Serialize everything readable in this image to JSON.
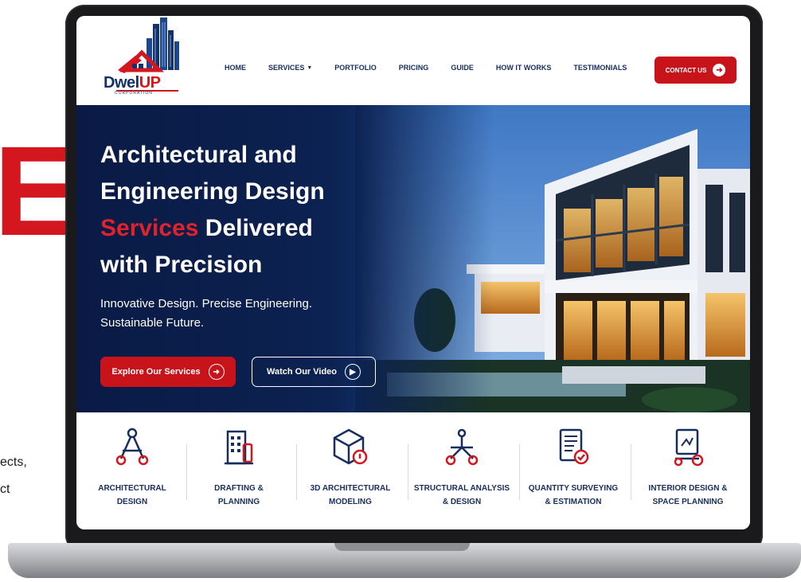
{
  "background": {
    "big_letter": "E",
    "fragment_1": "ects,",
    "fragment_2": "ct"
  },
  "nav": {
    "logo_text_main": "Dwel",
    "logo_text_accent": "UP",
    "logo_sub": "CORPORATION",
    "links": [
      {
        "label": "HOME"
      },
      {
        "label": "SERVICES",
        "icon": "chevron-down-icon"
      },
      {
        "label": "PORTFOLIO"
      },
      {
        "label": "PRICING"
      },
      {
        "label": "GUIDE"
      },
      {
        "label": "HOW IT WORKS"
      },
      {
        "label": "TESTIMONIALS"
      }
    ],
    "contact_label": "CONTACT US",
    "contact_icon": "arrow-right-circle-icon"
  },
  "hero": {
    "title_line1": "Architectural and",
    "title_line2": "Engineering Design",
    "title_accent": "Services",
    "title_line3_rest": " Delivered",
    "title_line4": "with Precision",
    "subtitle_line1": "Innovative Design. Precise Engineering.",
    "subtitle_line2": "Sustainable Future.",
    "explore_label": "Explore Our Services",
    "explore_icon": "arrow-right-circle-icon",
    "watch_label": "Watch Our Video",
    "watch_icon": "play-circle-icon"
  },
  "services": [
    {
      "label": "ARCHITECTURAL\nDESIGN",
      "icon": "compass-nodes-icon"
    },
    {
      "label": "DRAFTING &\nPLANNING",
      "icon": "building-plan-icon"
    },
    {
      "label": "3D ARCHITECTURAL\nMODELING",
      "icon": "3d-cube-icon"
    },
    {
      "label": "STRUCTURAL ANALYSIS\n& DESIGN",
      "icon": "structure-nodes-icon"
    },
    {
      "label": "QUANTITY SURVEYING\n& ESTIMATION",
      "icon": "document-estimate-icon"
    },
    {
      "label": "INTERIOR DESIGN &\nSPACE PLANNING",
      "icon": "interior-plan-icon"
    }
  ],
  "colors": {
    "brand_red": "#c8131b",
    "brand_navy": "#172d5e"
  }
}
